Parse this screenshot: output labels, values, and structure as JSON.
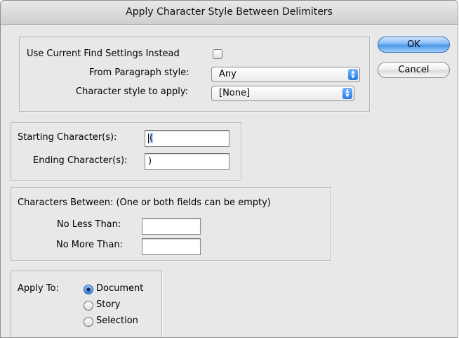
{
  "window": {
    "title": "Apply Character Style Between Delimiters"
  },
  "find_group": {
    "use_current_label": "Use Current Find Settings Instead",
    "from_para_label": "From Paragraph style:",
    "from_para_value": "Any",
    "char_style_label": "Character style to apply:",
    "char_style_value": "[None]"
  },
  "delimiters": {
    "start_label": "Starting Character(s):",
    "start_value": "(",
    "end_label": "Ending Character(s):",
    "end_value": ")"
  },
  "between": {
    "heading": "Characters Between: (One or both fields can be empty)",
    "no_less_label": "No Less Than:",
    "no_less_value": "",
    "no_more_label": "No More Than:",
    "no_more_value": ""
  },
  "apply_to": {
    "label": "Apply To:",
    "options": [
      "Document",
      "Story",
      "Selection"
    ],
    "selected": "Document"
  },
  "buttons": {
    "ok": "OK",
    "cancel": "Cancel"
  }
}
